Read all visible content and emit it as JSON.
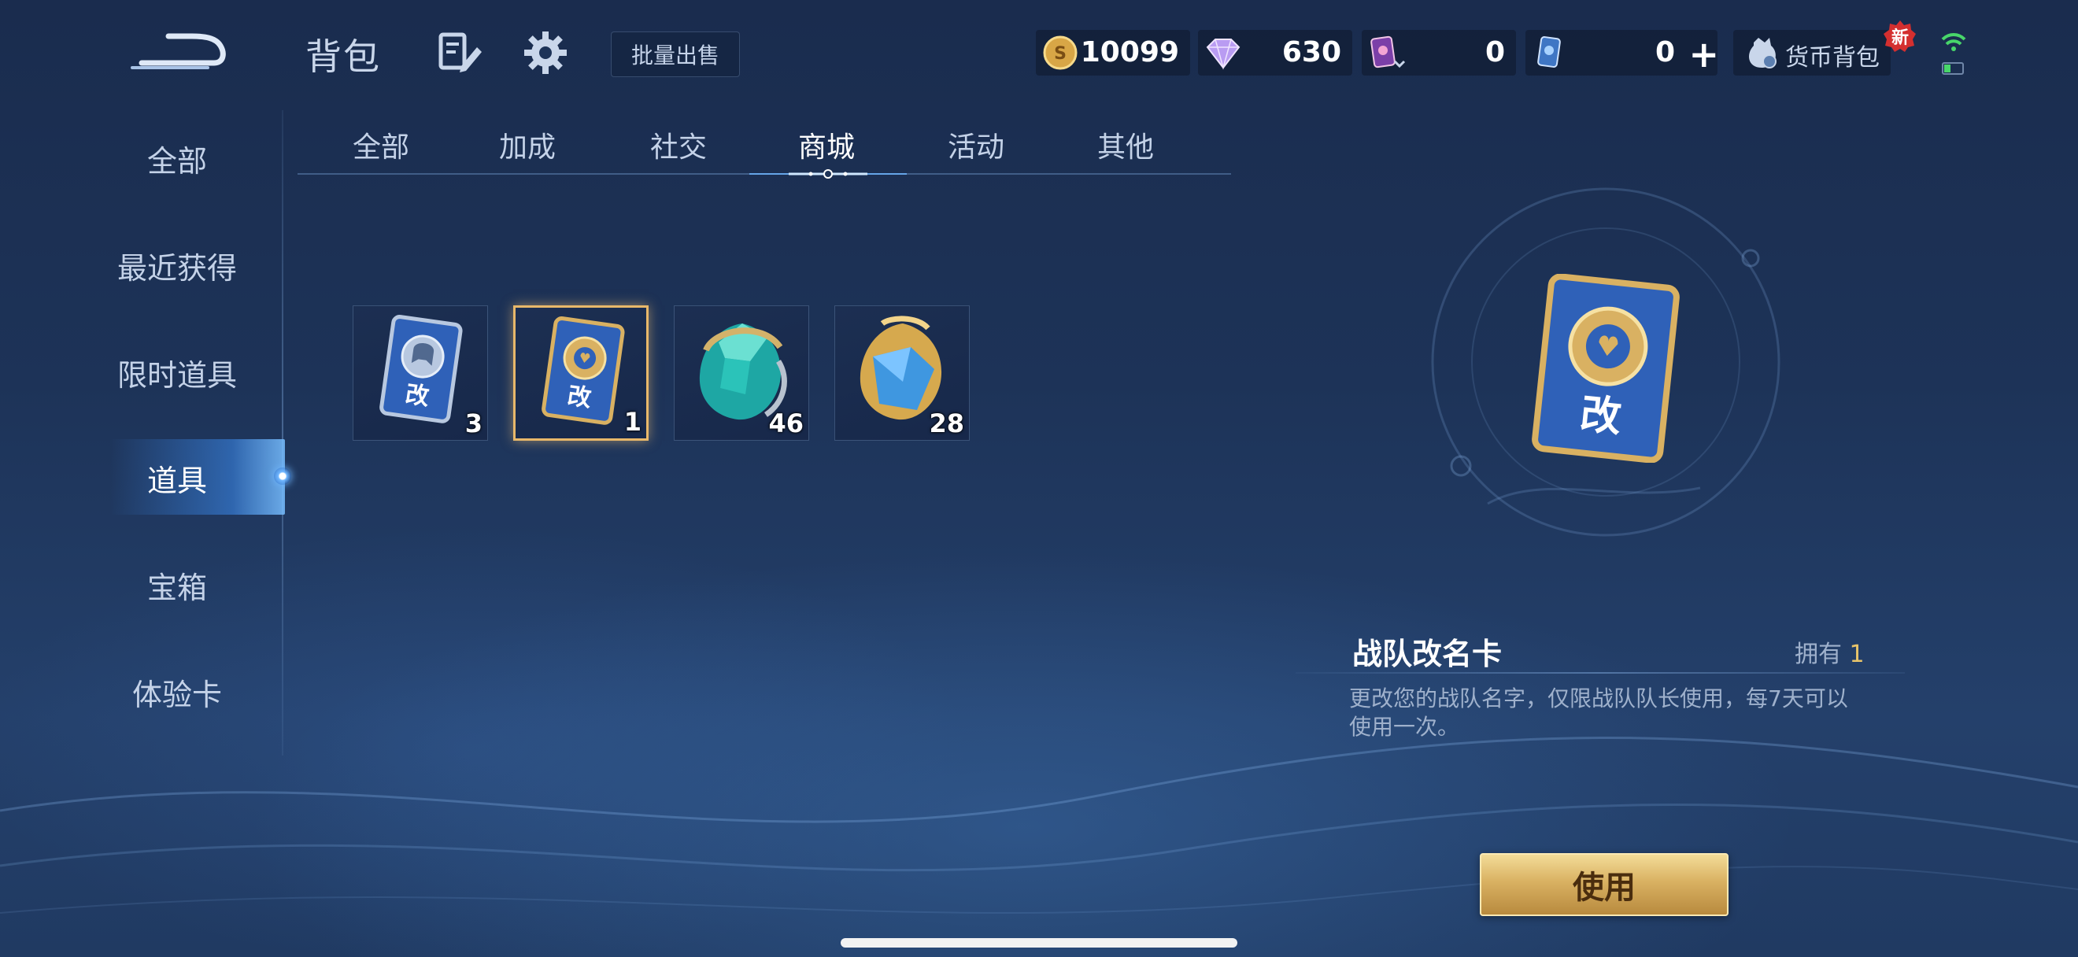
{
  "header": {
    "title": "背包",
    "bulk_sell": "批量出售",
    "wallet_label": "货币背包",
    "new_badge": "新"
  },
  "currencies": [
    {
      "name": "coin",
      "value": "10099"
    },
    {
      "name": "diamond",
      "value": "630"
    },
    {
      "name": "card-ticket-a",
      "value": "0"
    },
    {
      "name": "card-ticket-b",
      "value": "0"
    }
  ],
  "sidebar": {
    "items": [
      {
        "label": "全部"
      },
      {
        "label": "最近获得"
      },
      {
        "label": "限时道具"
      },
      {
        "label": "道具"
      },
      {
        "label": "宝箱"
      },
      {
        "label": "体验卡"
      }
    ],
    "active": "道具"
  },
  "tabs": {
    "items": [
      {
        "label": "全部"
      },
      {
        "label": "加成"
      },
      {
        "label": "社交"
      },
      {
        "label": "商城"
      },
      {
        "label": "活动"
      },
      {
        "label": "其他"
      }
    ],
    "active": "商城"
  },
  "grid": {
    "items": [
      {
        "icon": "rename-card-silver-icon",
        "card_text": "改",
        "count": "3"
      },
      {
        "icon": "team-rename-card-icon",
        "card_text": "改",
        "count": "1",
        "selected": true
      },
      {
        "icon": "jade-crystal-icon",
        "count": "46"
      },
      {
        "icon": "blue-crystal-icon",
        "count": "28"
      }
    ]
  },
  "detail": {
    "card_text": "改",
    "name": "战队改名卡",
    "own_label": "拥有",
    "own_count": "1",
    "description": "更改您的战队名字，仅限战队队长使用，每7天可以使用一次。",
    "use_button": "使用"
  },
  "colors": {
    "accent_gold": "#e8c46a",
    "tab_glow": "#6fb6ff",
    "background": "#1d3358"
  }
}
